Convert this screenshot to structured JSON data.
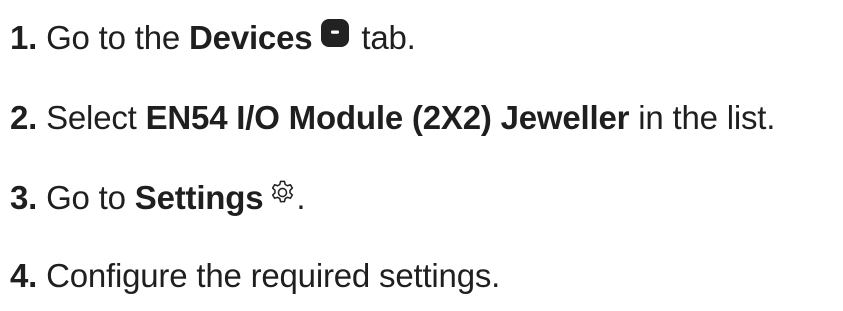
{
  "steps": [
    {
      "number": "1.",
      "prefix": "Go to the",
      "bold": "Devices",
      "icon": "devices-tab-icon",
      "suffix": "tab."
    },
    {
      "number": "2.",
      "prefix": "Select",
      "bold": "EN54 I/O Module (2X2) Jeweller",
      "suffix": "in the list."
    },
    {
      "number": "3.",
      "prefix": "Go to",
      "bold": "Settings",
      "icon": "gear-icon",
      "suffix": "."
    },
    {
      "number": "4.",
      "text": "Configure the required settings."
    }
  ],
  "colors": {
    "text": "#1f1f1f",
    "icon": "#222222"
  }
}
